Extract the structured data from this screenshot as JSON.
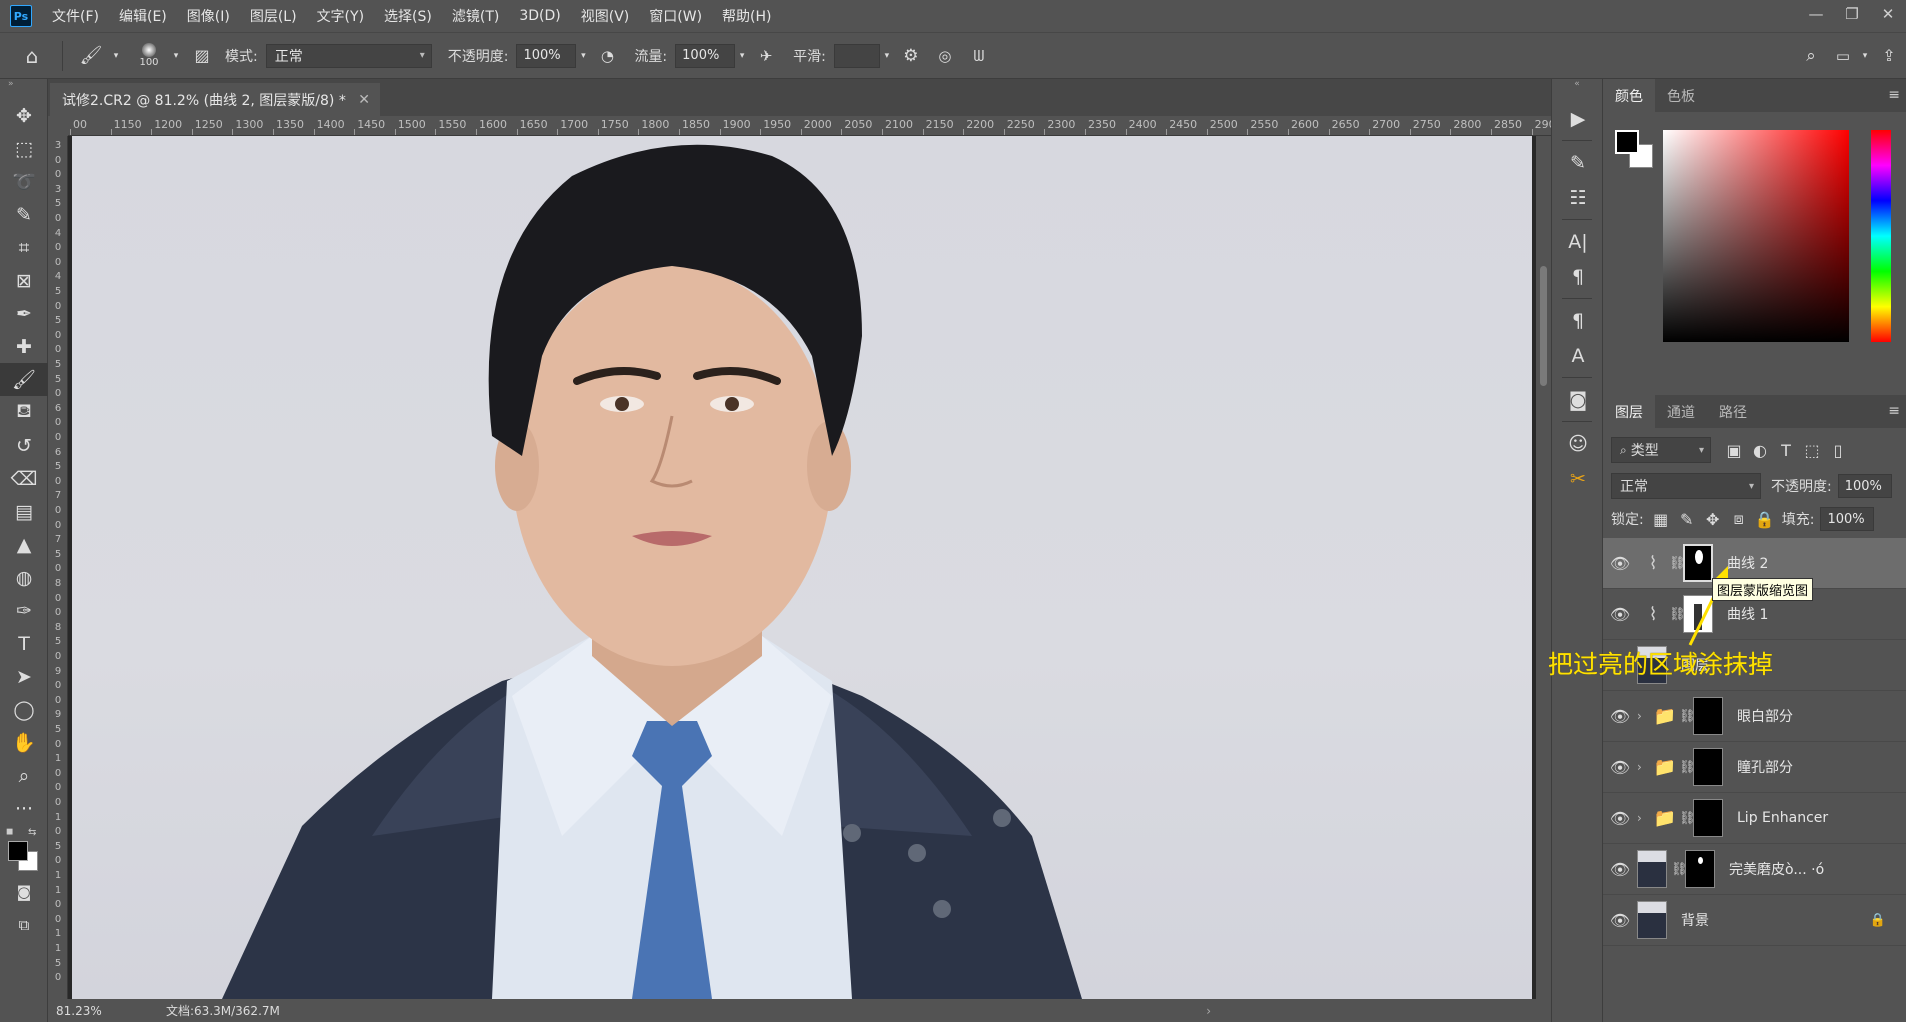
{
  "menubar": {
    "items": [
      "文件(F)",
      "编辑(E)",
      "图像(I)",
      "图层(L)",
      "文字(Y)",
      "选择(S)",
      "滤镜(T)",
      "3D(D)",
      "视图(V)",
      "窗口(W)",
      "帮助(H)"
    ]
  },
  "options": {
    "brush_size": "100",
    "mode_label": "模式:",
    "mode_value": "正常",
    "opacity_label": "不透明度:",
    "opacity_value": "100%",
    "flow_label": "流量:",
    "flow_value": "100%",
    "smoothing_label": "平滑:",
    "smoothing_value": ""
  },
  "document": {
    "tab_title": "试修2.CR2 @ 81.2% (曲线 2, 图层蒙版/8) *",
    "ruler_top": [
      "00",
      "1150",
      "1200",
      "1250",
      "1300",
      "1350",
      "1400",
      "1450",
      "1500",
      "1550",
      "1600",
      "1650",
      "1700",
      "1750",
      "1800",
      "1850",
      "1900",
      "1950",
      "2000",
      "2050",
      "2100",
      "2150",
      "2200",
      "2250",
      "2300",
      "2350",
      "2400",
      "2450",
      "2500",
      "2550",
      "2600",
      "2650",
      "2700",
      "2750",
      "2800",
      "2850",
      "290"
    ],
    "ruler_left": [
      "3",
      "0",
      "0",
      "3",
      "5",
      "0",
      "4",
      "0",
      "0",
      "4",
      "5",
      "0",
      "5",
      "0",
      "0",
      "5",
      "5",
      "0",
      "6",
      "0",
      "0",
      "6",
      "5",
      "0",
      "7",
      "0",
      "0",
      "7",
      "5",
      "0",
      "8",
      "0",
      "0",
      "8",
      "5",
      "0",
      "9",
      "0",
      "0",
      "9",
      "5",
      "0",
      "1",
      "0",
      "0",
      "0",
      "1",
      "0",
      "5",
      "0",
      "1",
      "1",
      "0",
      "0",
      "1",
      "1",
      "5",
      "0"
    ]
  },
  "status": {
    "zoom": "81.23%",
    "doc_info": "文档:63.3M/362.7M"
  },
  "color_panel": {
    "tabs": [
      "颜色",
      "色板"
    ],
    "foreground": "#000000",
    "background": "#ffffff"
  },
  "layers_panel": {
    "tabs": [
      "图层",
      "通道",
      "路径"
    ],
    "filter": "类型",
    "blend_mode": "正常",
    "opacity_label": "不透明度:",
    "opacity_value": "100%",
    "lock_label": "锁定:",
    "fill_label": "填充:",
    "fill_value": "100%",
    "layers": [
      {
        "name": "曲线 2",
        "kind": "curves",
        "selected": true
      },
      {
        "name": "曲线 1",
        "kind": "curves",
        "selected": false
      },
      {
        "name": "图层",
        "kind": "pixel",
        "selected": false
      },
      {
        "name": "眼白部分",
        "kind": "group",
        "selected": false
      },
      {
        "name": "瞳孔部分",
        "kind": "group",
        "selected": false
      },
      {
        "name": "Lip Enhancer",
        "kind": "group",
        "selected": false
      },
      {
        "name": "完美磨皮ò... ·ó",
        "kind": "masked-pixel",
        "selected": false
      },
      {
        "name": "背景",
        "kind": "background",
        "selected": false
      }
    ]
  },
  "tooltip": "图层蒙版缩览图",
  "annotation": "把过亮的区域涂抹掉",
  "annotation_color": "#ffe100"
}
